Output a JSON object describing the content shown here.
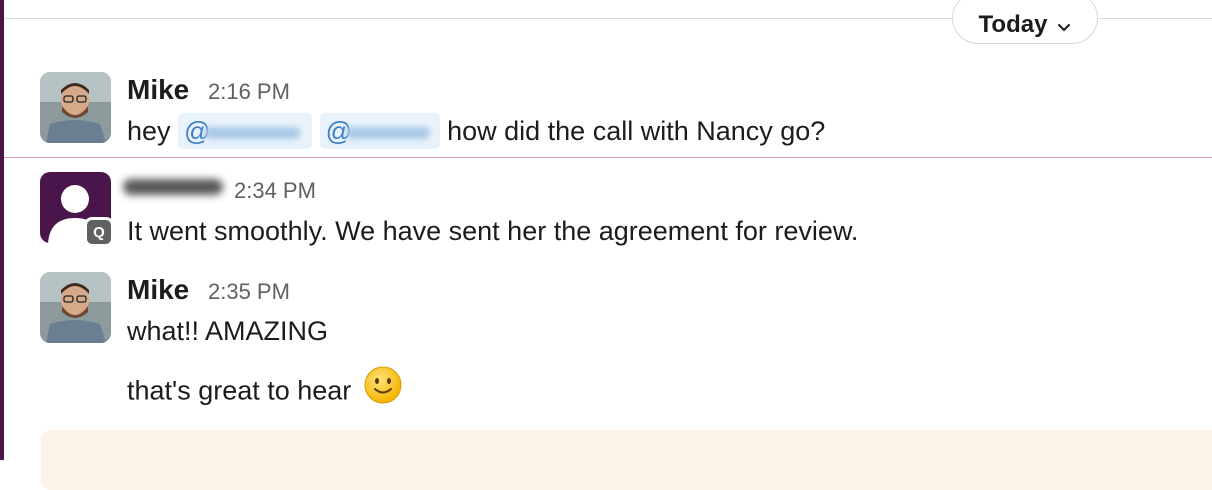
{
  "day_divider": {
    "label": "Today"
  },
  "messages": [
    {
      "author": "Mike",
      "time": "2:16 PM",
      "text_prefix": "hey",
      "text_suffix": "how did the call with Nancy go?"
    },
    {
      "author": "",
      "time": "2:34 PM",
      "badge": "Q",
      "text": "It went smoothly. We have sent her the agreement for review."
    },
    {
      "author": "Mike",
      "time": "2:35 PM",
      "lines": [
        "what!! AMAZING",
        "that's great to hear"
      ]
    }
  ],
  "icons": {
    "day_chevron": "chevron-down-icon",
    "emoji": "slightly-smiling-face-icon",
    "avatar_default": "user-placeholder-icon"
  },
  "colors": {
    "rail": "#4a154b",
    "new_messages_line": "#e3a3b8",
    "mention_bg": "#e8f2fb",
    "composer_bg": "#fcf3e8"
  }
}
